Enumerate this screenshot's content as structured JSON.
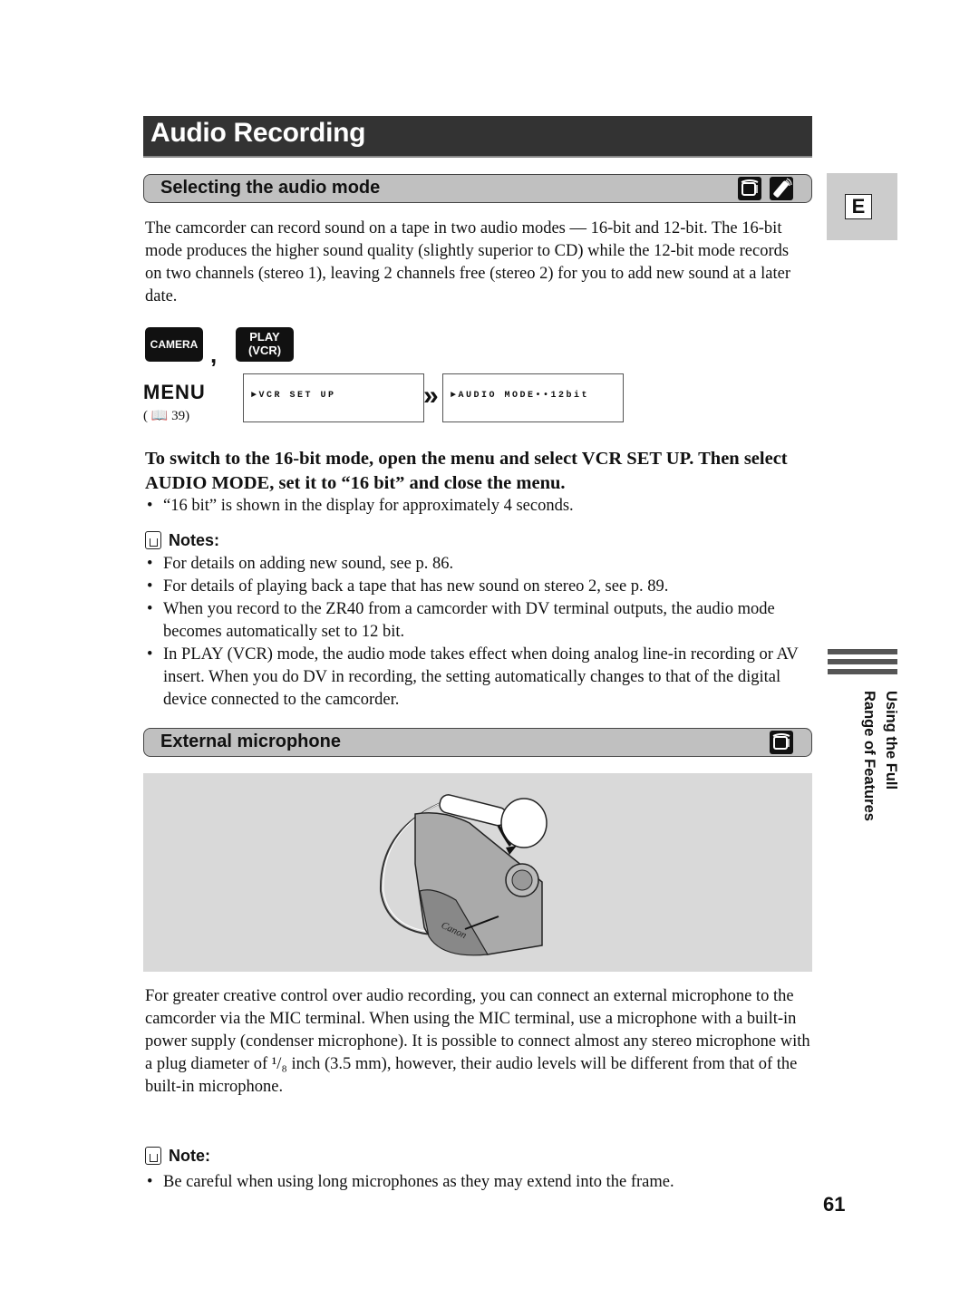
{
  "page": {
    "title": "Audio Recording",
    "language_tab": "E",
    "side_label_line1": "Using the Full",
    "side_label_line2": "Range of Features",
    "page_number": "61"
  },
  "section1": {
    "heading": "Selecting the audio mode",
    "mode_icons": [
      "camcorder-icon",
      "wireless-remote-icon"
    ],
    "intro": "The camcorder can record sound on a tape in two audio modes — 16-bit and 12-bit. The 16-bit mode produces the higher sound quality (slightly superior to CD) while the 12-bit mode records on two channels (stereo 1), leaving 2 channels free (stereo 2) for you to add new sound at a later date.",
    "mode_buttons": {
      "camera": "CAMERA",
      "separator": ",",
      "play_line1": "PLAY",
      "play_line2": "(VCR)"
    },
    "menu": {
      "label": "MENU",
      "ref": "( 📖 39)",
      "step1": "►VCR SET UP",
      "step2": "►AUDIO MODE••12bit",
      "arrow": "»"
    },
    "instruction": "To switch to the 16-bit mode, open the menu and select VCR SET UP. Then select AUDIO MODE, set it to “16 bit” and close the menu.",
    "instruction_bullet": "“16 bit” is shown in the display for approximately 4 seconds.",
    "notes_heading": "Notes:",
    "notes": [
      "For details on adding new sound, see p. 86.",
      "For details of playing back a tape that has new sound on stereo 2, see p. 89.",
      "When you record to the ZR40 from a camcorder with DV terminal outputs, the audio mode becomes automatically set to 12 bit.",
      "In PLAY (VCR) mode, the audio mode takes effect when doing analog line-in recording or AV insert. When you do DV in recording, the setting automatically changes to that of the digital device connected to the camcorder."
    ]
  },
  "section2": {
    "heading": "External microphone",
    "mode_icons": [
      "camcorder-icon"
    ],
    "figure_brand": "Canon",
    "body": "For greater creative control over audio recording, you can connect an external microphone to the camcorder via the MIC terminal. When using the MIC terminal, use a microphone with a built-in power supply (condenser microphone). It is possible to connect almost any stereo microphone with a plug diameter of ¹/₈ inch (3.5 mm), however, their audio levels will be different from that of the built-in microphone.",
    "note_heading": "Note:",
    "notes": [
      "Be careful when using long microphones as they may extend into the frame."
    ]
  }
}
